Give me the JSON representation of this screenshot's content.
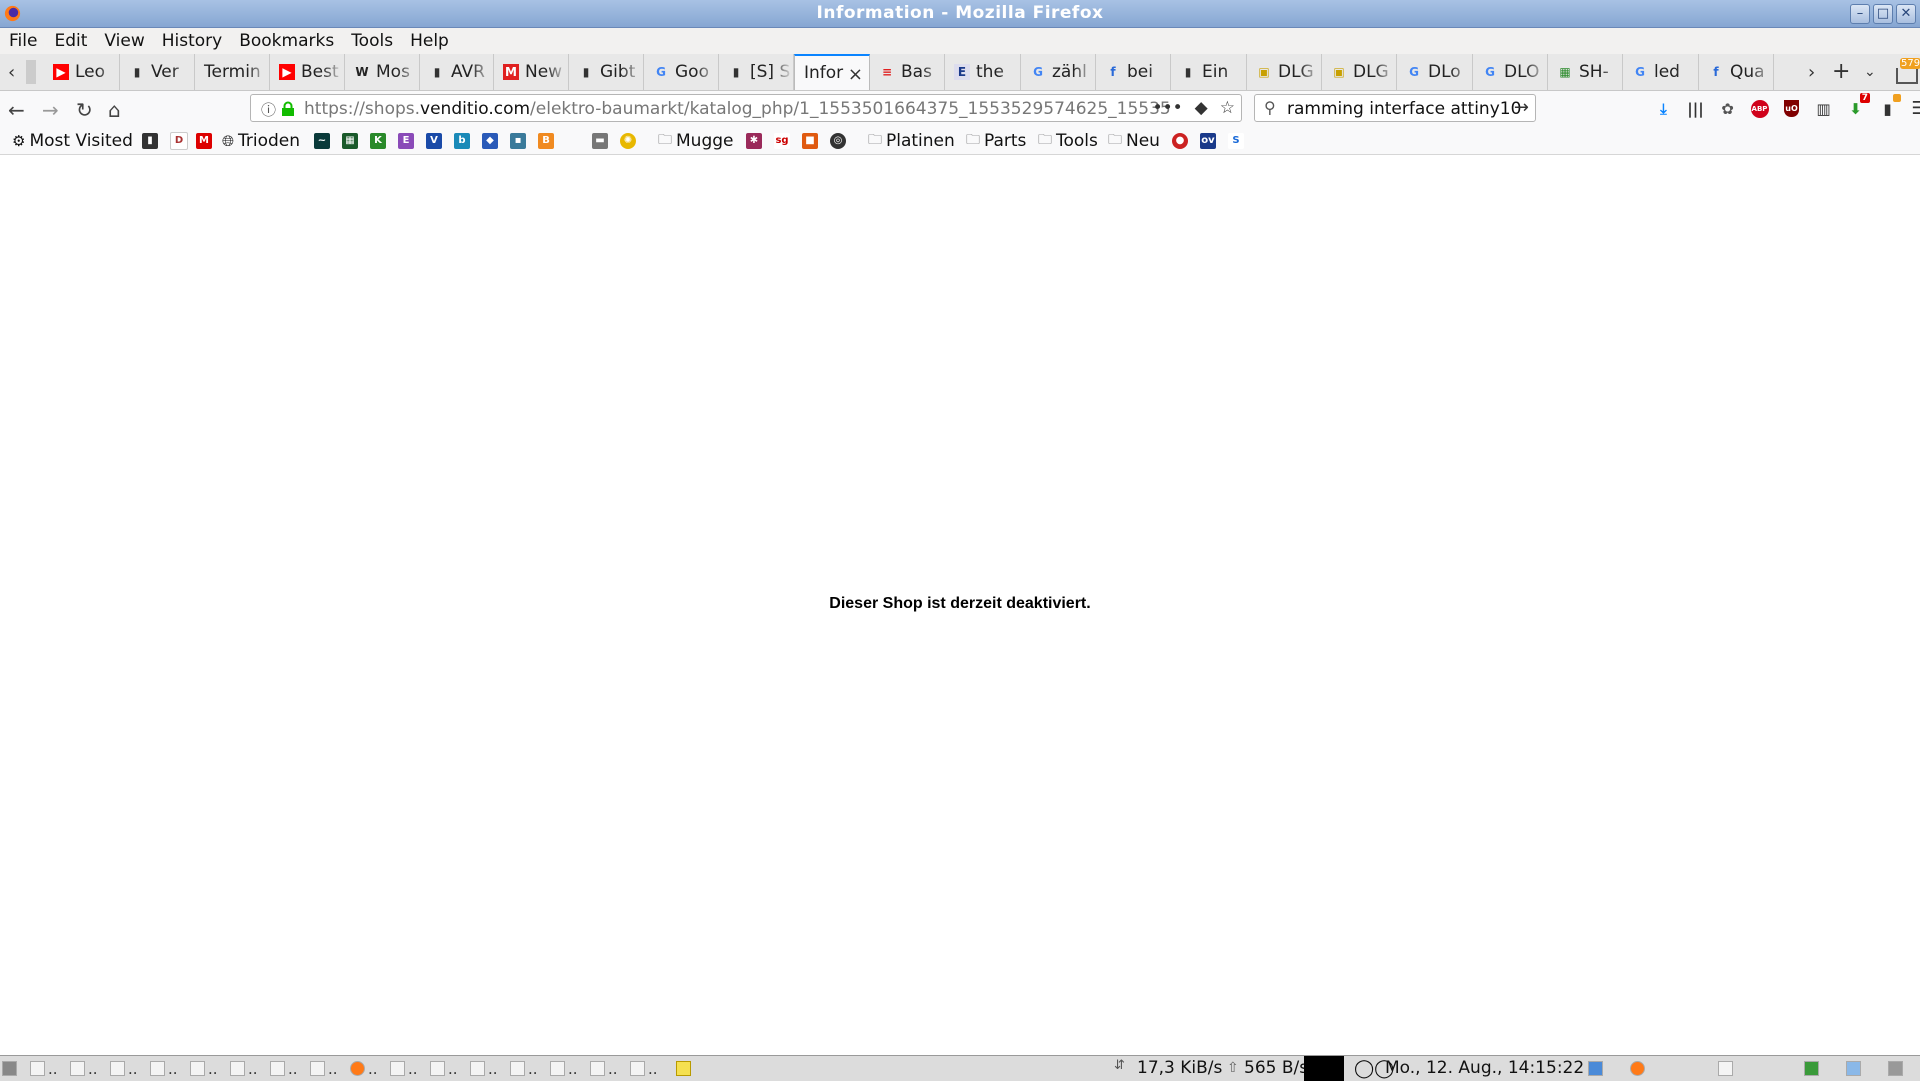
{
  "window": {
    "title": "Information - Mozilla Firefox",
    "buttons": [
      "minimize",
      "maximize",
      "close"
    ]
  },
  "menubar": {
    "items": [
      "File",
      "Edit",
      "View",
      "History",
      "Bookmarks",
      "Tools",
      "Help"
    ]
  },
  "tabs": {
    "items": [
      {
        "label": "Leo",
        "icon": "youtube-icon"
      },
      {
        "label": "Ver",
        "icon": "page-icon"
      },
      {
        "label": "Termin",
        "icon": "none"
      },
      {
        "label": "Best",
        "icon": "youtube-icon"
      },
      {
        "label": "Mos",
        "icon": "wikipedia-icon"
      },
      {
        "label": "AVR",
        "icon": "page-icon"
      },
      {
        "label": "New",
        "icon": "microchip-icon"
      },
      {
        "label": "Gibt",
        "icon": "page-icon"
      },
      {
        "label": "Goo",
        "icon": "google-icon"
      },
      {
        "label": "[S] S",
        "icon": "page-icon"
      },
      {
        "label": "Infor",
        "icon": "none",
        "active": true
      },
      {
        "label": "Bas",
        "icon": "stripes-icon"
      },
      {
        "label": "the",
        "icon": "e-icon"
      },
      {
        "label": "zähl",
        "icon": "google-icon"
      },
      {
        "label": "bei",
        "icon": "forum-icon"
      },
      {
        "label": "Ein",
        "icon": "page-icon"
      },
      {
        "label": "DLG",
        "icon": "shop-icon"
      },
      {
        "label": "DLG",
        "icon": "shop-icon"
      },
      {
        "label": "DLo",
        "icon": "google-icon"
      },
      {
        "label": "DLO",
        "icon": "google-icon"
      },
      {
        "label": "SH-",
        "icon": "grid-icon"
      },
      {
        "label": "led",
        "icon": "google-icon"
      },
      {
        "label": "Qua",
        "icon": "forum-icon"
      }
    ],
    "tab_count_badge": "579"
  },
  "navbar": {
    "url_prefix": "https://shops.",
    "url_domain": "venditio.com",
    "url_path": "/elektro-baumarkt/katalog_php/1_1553501664375_1553529574625_15535",
    "search_value": "ramming interface attiny10",
    "notification_count": "7"
  },
  "bookmarks": {
    "items": [
      {
        "label": "Most Visited",
        "icon": "gear-icon"
      },
      {
        "label": "Trioden",
        "icon": "globe-icon"
      },
      {
        "label": "Mugge",
        "icon": "folder-icon"
      },
      {
        "label": "Platinen",
        "icon": "folder-icon"
      },
      {
        "label": "Parts",
        "icon": "folder-icon"
      },
      {
        "label": "Tools",
        "icon": "folder-icon"
      },
      {
        "label": "Neu",
        "icon": "folder-icon"
      }
    ]
  },
  "content": {
    "message": "Dieser Shop ist derzeit deaktiviert."
  },
  "taskbar": {
    "net_down": "17,3 KiB/s",
    "net_up": "565 B/s",
    "clock": "Mo., 12. Aug., 14:15:22",
    "task_ellipsis": ".."
  },
  "colors": {
    "titlebar": "#94b2da",
    "accent": "#0a84ff",
    "youtube": "#ff0000",
    "lock": "#12bc00"
  }
}
